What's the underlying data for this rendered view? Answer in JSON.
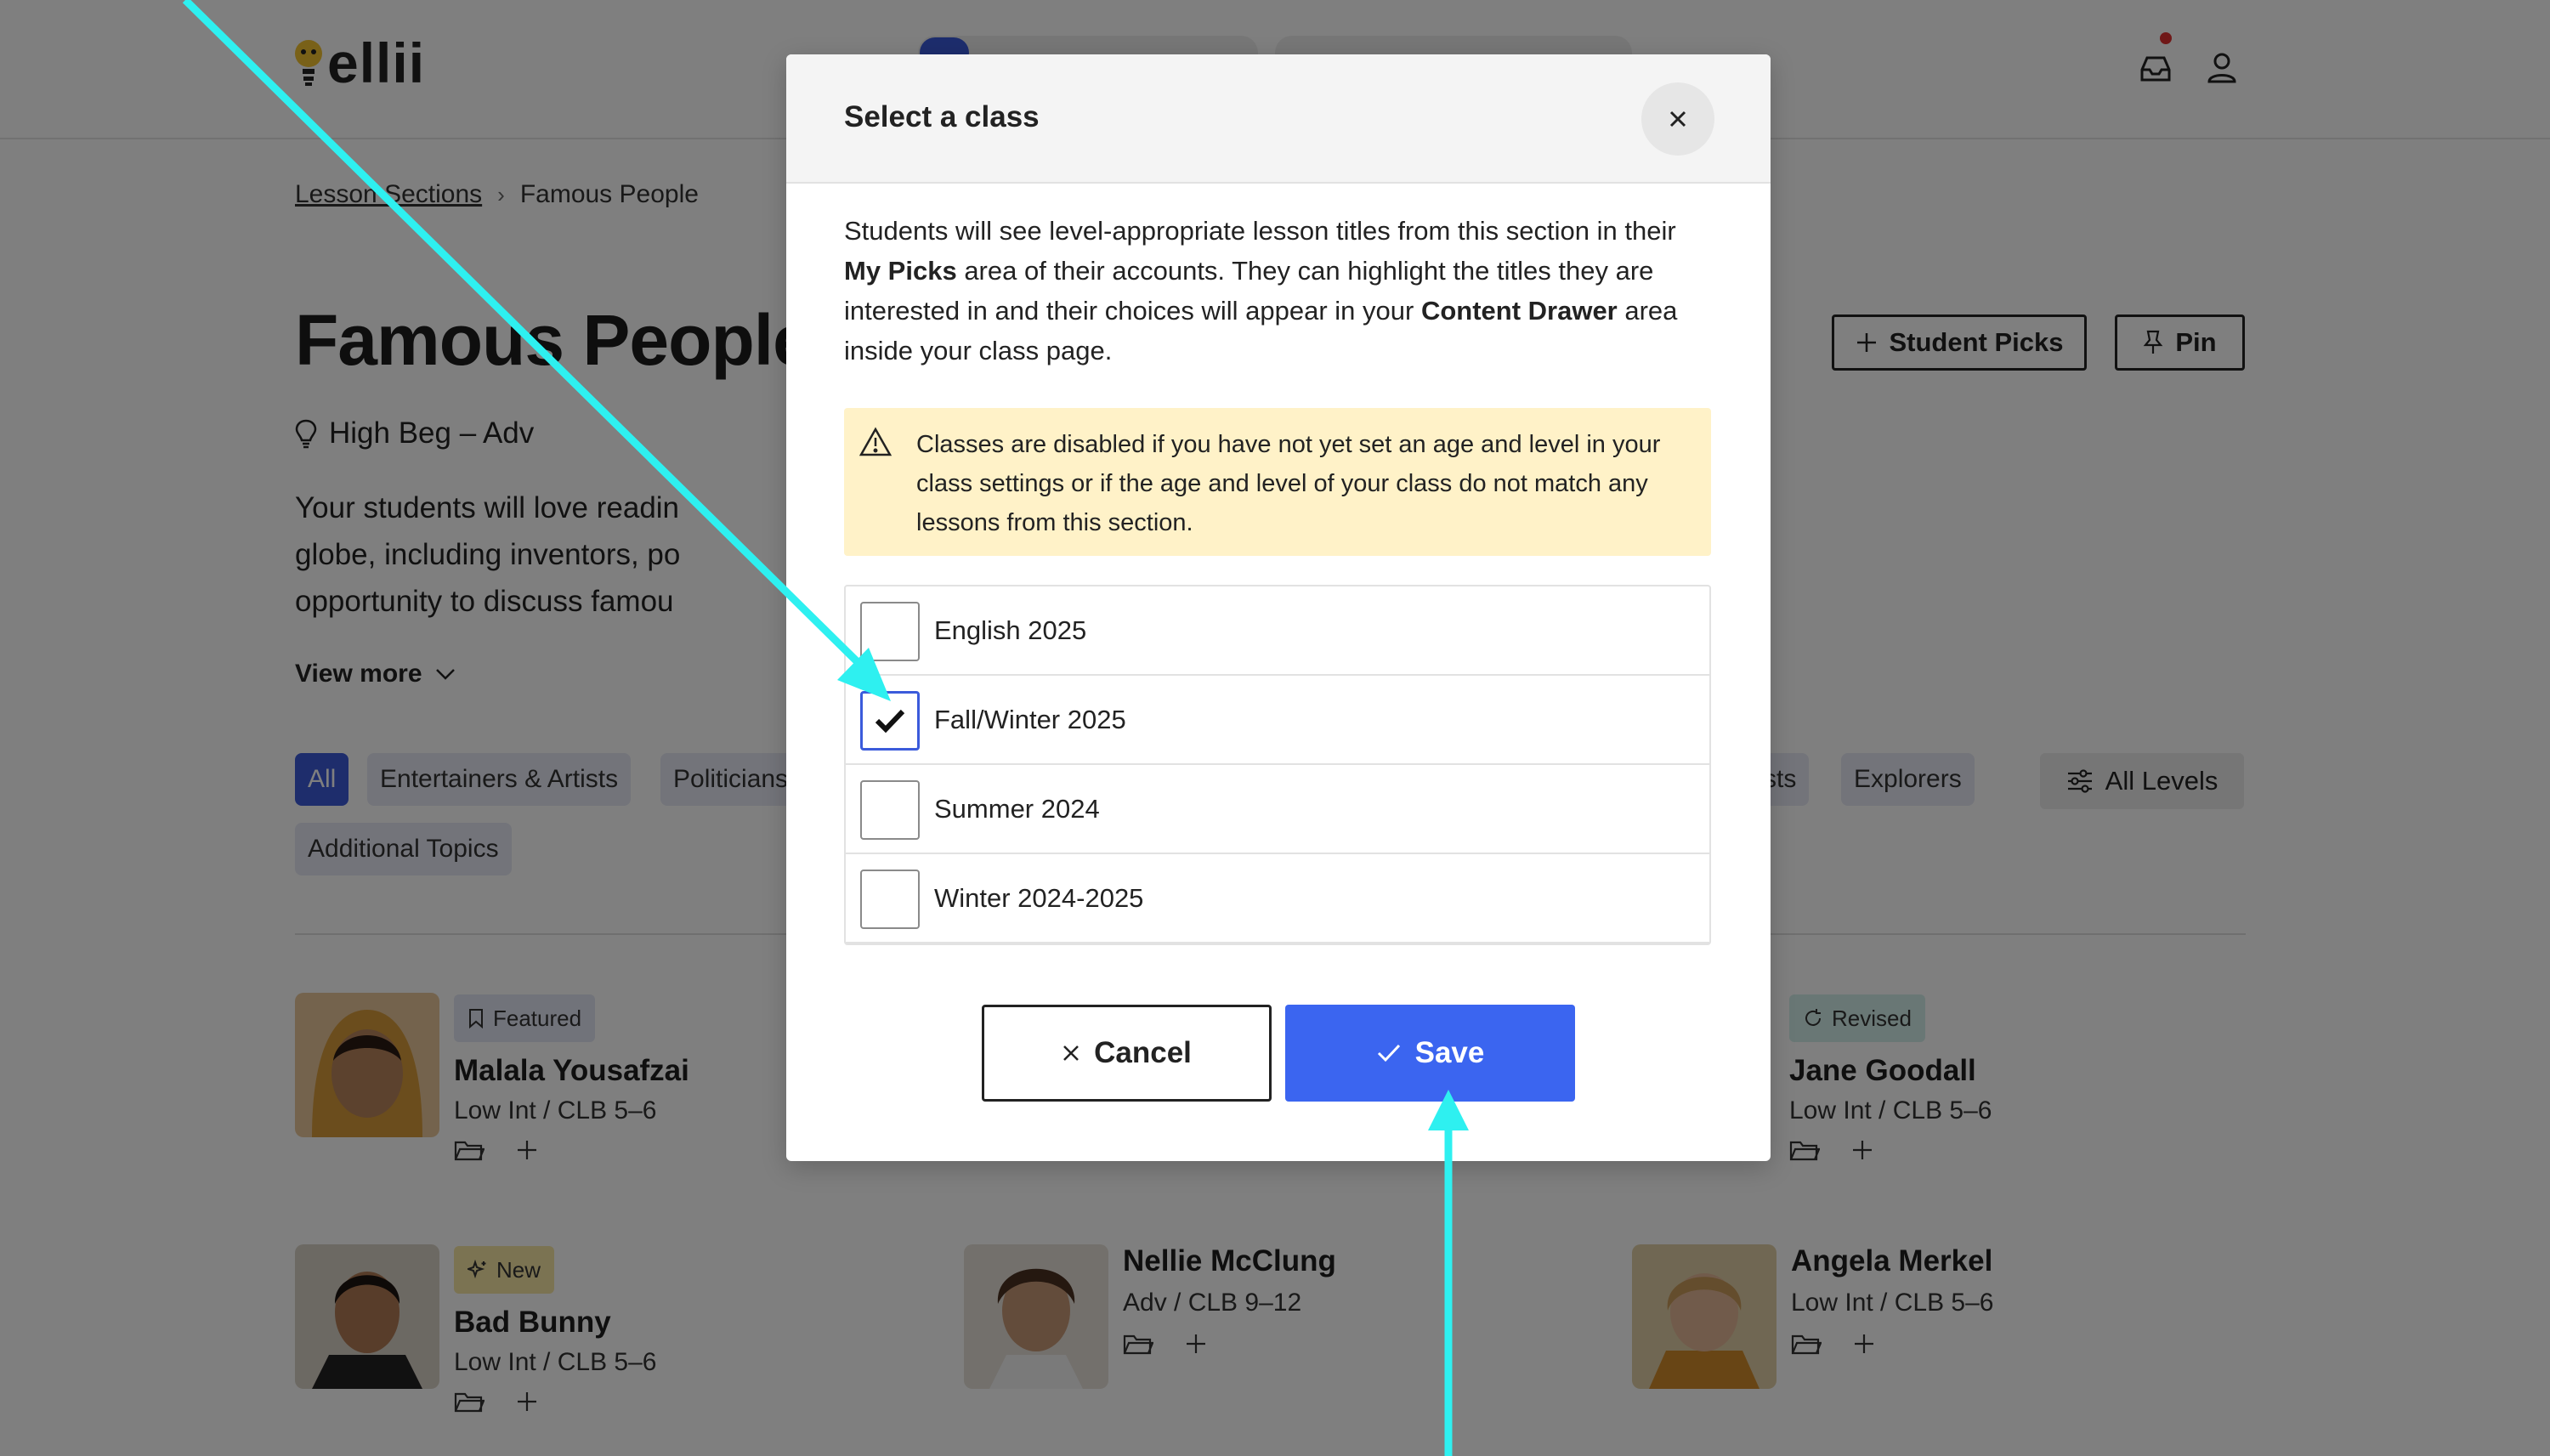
{
  "app": {
    "logo_text": "ellii"
  },
  "breadcrumb": {
    "parent": "Lesson Sections",
    "separator": "›",
    "current": "Famous People"
  },
  "page": {
    "title": "Famous People",
    "level": "High Beg – Adv",
    "intro_lines": [
      "Your students will love readin",
      "globe, including inventors, po",
      "opportunity to discuss famou"
    ],
    "view_more": "View more"
  },
  "toolbar": {
    "student_picks": "Student Picks",
    "pin": "Pin"
  },
  "filters": {
    "chips": [
      "All",
      "Entertainers & Artists",
      "Politicians",
      "tists",
      "Explorers",
      "Additional Topics"
    ],
    "all_levels": "All Levels"
  },
  "cards": [
    {
      "badge": "Featured",
      "name": "Malala Yousafzai",
      "level": "Low Int / CLB 5–6"
    },
    {
      "badge": "Revised",
      "name": "Jane Goodall",
      "level": "Low Int / CLB 5–6"
    },
    {
      "badge": "New",
      "name": "Bad Bunny",
      "level": "Low Int / CLB 5–6"
    },
    {
      "badge": "",
      "name": "Nellie McClung",
      "level": "Adv / CLB 9–12"
    },
    {
      "badge": "",
      "name": "Angela Merkel",
      "level": "Low Int / CLB 5–6"
    }
  ],
  "modal": {
    "title": "Select a class",
    "desc_1": "Students will see level-appropriate lesson titles from this section in their",
    "desc_b1": "My Picks",
    "desc_2": " area of their accounts. They can highlight the titles they are interested in and their choices will appear in your ",
    "desc_b2": "Content Drawer",
    "desc_3": " area inside your class page.",
    "warning": "Classes are disabled if you have not yet set an age and level in your class settings or if the age and level of your class do not match any lessons from this section.",
    "classes": [
      {
        "label": "English 2025",
        "checked": false
      },
      {
        "label": "Fall/Winter 2025",
        "checked": true
      },
      {
        "label": "Summer 2024",
        "checked": false
      },
      {
        "label": "Winter 2024-2025",
        "checked": false
      }
    ],
    "cancel": "Cancel",
    "save": "Save"
  },
  "colors": {
    "accent": "#3b65f0",
    "annotation": "#2ef0f0",
    "warning_bg": "#fff2c8"
  }
}
